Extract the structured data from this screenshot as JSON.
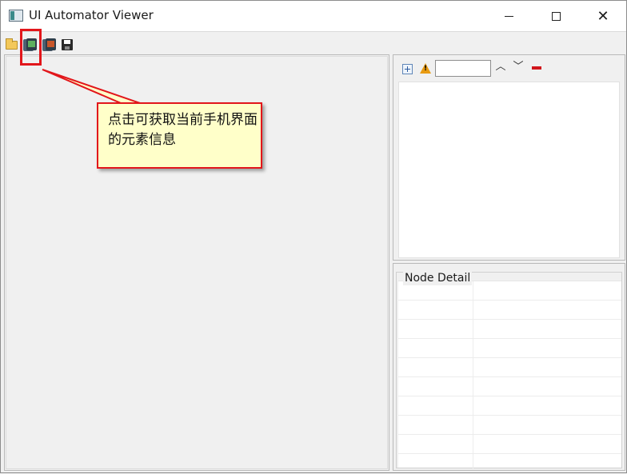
{
  "window": {
    "title": "UI Automator Viewer",
    "controls": {
      "minimize": "minimize-icon",
      "maximize": "maximize-icon",
      "close": "✕"
    }
  },
  "toolbar": {
    "icons": [
      "open-folder-icon",
      "device-screenshot-icon",
      "device-screenshot-compressed-icon",
      "save-icon"
    ]
  },
  "hierarchy": {
    "toolbar_icons": [
      "expand-all-icon",
      "warning-icon",
      "search-field",
      "prev-icon",
      "next-icon",
      "clear-icon"
    ],
    "search_value": "",
    "prev_glyph": "︿",
    "next_glyph": "﹀"
  },
  "node_detail": {
    "title": "Node Detail",
    "rows": [
      {
        "key": "",
        "value": ""
      },
      {
        "key": "",
        "value": ""
      },
      {
        "key": "",
        "value": ""
      },
      {
        "key": "",
        "value": ""
      },
      {
        "key": "",
        "value": ""
      },
      {
        "key": "",
        "value": ""
      },
      {
        "key": "",
        "value": ""
      },
      {
        "key": "",
        "value": ""
      },
      {
        "key": "",
        "value": ""
      },
      {
        "key": "",
        "value": ""
      }
    ]
  },
  "annotation": {
    "text": "点击可获取当前手机界面的元素信息"
  },
  "colors": {
    "highlight": "#e2161b",
    "callout_bg": "#ffffc9",
    "window_bg": "#f0f0f0"
  }
}
